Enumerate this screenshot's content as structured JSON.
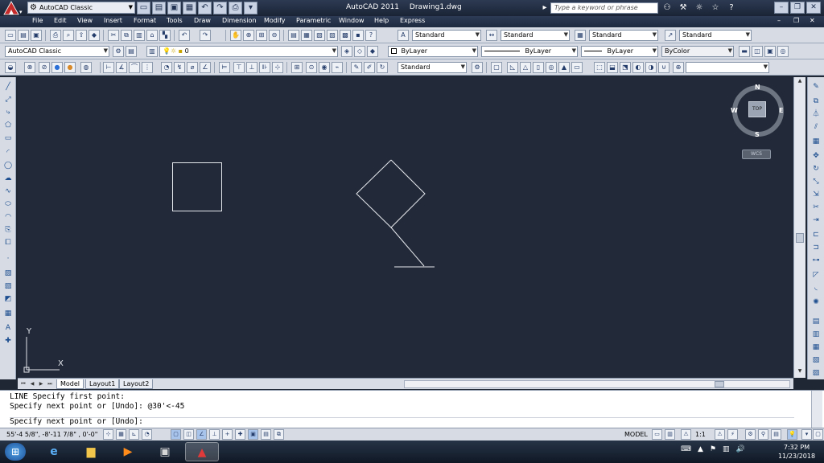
{
  "titlebar": {
    "workspace": "AutoCAD Classic",
    "app_title": "AutoCAD 2011",
    "doc_title": "Drawing1.dwg",
    "search_placeholder": "Type a keyword or phrase"
  },
  "menu": [
    "File",
    "Edit",
    "View",
    "Insert",
    "Format",
    "Tools",
    "Draw",
    "Dimension",
    "Modify",
    "Parametric",
    "Window",
    "Help",
    "Express"
  ],
  "toolbar1": {
    "text_style": "Standard",
    "dim_style": "Standard",
    "table_style": "Standard",
    "mleader_style": "Standard"
  },
  "toolbar2": {
    "workspace": "AutoCAD Classic",
    "layer": "0",
    "color": "ByLayer",
    "linetype": "ByLayer",
    "lineweight": "ByLayer",
    "plotstyle": "ByColor"
  },
  "toolbar3": {
    "visual_style": "Standard"
  },
  "viewcube": {
    "north": "N",
    "south": "S",
    "east": "E",
    "west": "W",
    "face": "TOP",
    "wcs": "WCS"
  },
  "ucs": {
    "x": "X",
    "y": "Y"
  },
  "tabs": [
    "Model",
    "Layout1",
    "Layout2"
  ],
  "command": {
    "line1": "LINE Specify first point:",
    "line2": "Specify next point or [Undo]: @30'<-45",
    "prompt": "Specify next point or [Undo]:"
  },
  "status": {
    "coords": "55'-4 5/8\",  -8'-11 7/8\" , 0'-0\"",
    "model": "MODEL",
    "scale": "1:1"
  },
  "clock": {
    "time": "7:32 PM",
    "date": "11/23/2018"
  }
}
